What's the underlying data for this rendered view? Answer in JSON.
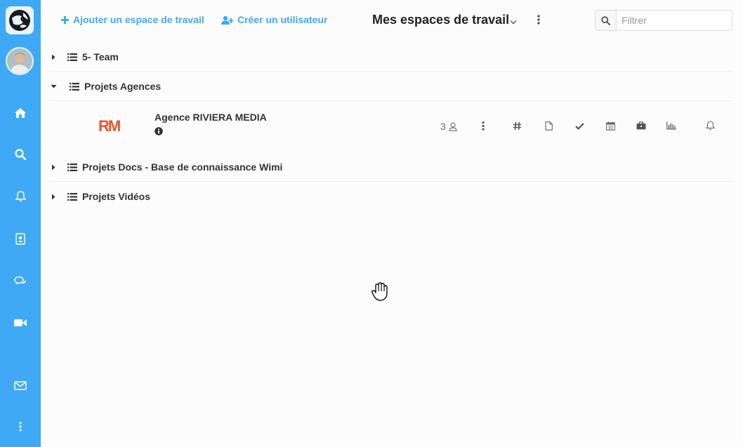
{
  "toolbar": {
    "add_workspace_label": "Ajouter un espace de travail",
    "create_user_label": "Créer un utilisateur",
    "title": "Mes espaces de travail",
    "filter_placeholder": "Filtrer"
  },
  "groups": [
    {
      "label": "5- Team",
      "expanded": false
    },
    {
      "label": "Projets Agences",
      "expanded": true
    },
    {
      "label": "Projets Docs - Base de connaissance Wimi",
      "expanded": false
    },
    {
      "label": "Projets Vidéos",
      "expanded": false
    }
  ],
  "workspace": {
    "logo_text": "RM",
    "name": "Agence RIVIERA MEDIA",
    "member_count": "3"
  },
  "colors": {
    "sidebar": "#3fa9f5",
    "accent": "#3fa9f5",
    "logo_orange": "#e8552b"
  },
  "sidebar_icons": [
    "home-icon",
    "search-icon",
    "bell-icon",
    "contacts-icon",
    "chat-icon",
    "video-icon",
    "mail-icon",
    "more-vertical-icon"
  ],
  "workspace_actions": [
    "more-vertical-icon",
    "hashtag-icon",
    "document-icon",
    "checkmark-icon",
    "calendar-icon",
    "briefcase-icon",
    "bar-chart-icon",
    "bell-icon"
  ]
}
